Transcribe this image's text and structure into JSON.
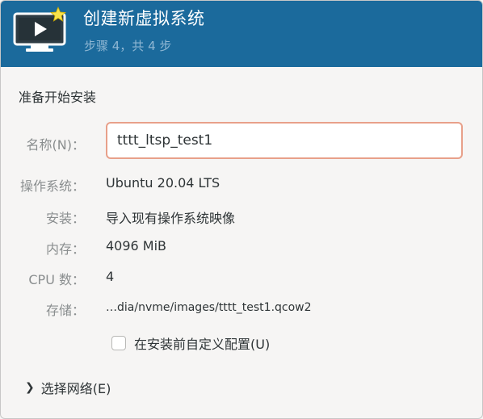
{
  "header": {
    "title": "创建新虚拟系统",
    "subtitle": "步骤 4，共 4 步",
    "icon": "monitor-play-star-icon"
  },
  "section_title": "准备开始安装",
  "form": {
    "name_label": "名称(N)：",
    "name_value": "tttt_ltsp_test1"
  },
  "summary": [
    {
      "label": "操作系统：",
      "value": "Ubuntu 20.04 LTS"
    },
    {
      "label": "安装：",
      "value": "导入现有操作系统映像"
    },
    {
      "label": "内存：",
      "value": "4096 MiB"
    },
    {
      "label": "CPU 数：",
      "value": "4"
    },
    {
      "label": "存储：",
      "value": "…dia/nvme/images/tttt_test1.qcow2"
    }
  ],
  "customize_checkbox": {
    "label": "在安装前自定义配置(U)",
    "checked": false
  },
  "network_expander": {
    "label": "选择网络(E)",
    "icon": "chevron-right-icon"
  },
  "colors": {
    "header_bg": "#1b6a9c",
    "input_border": "#e8a08a"
  }
}
